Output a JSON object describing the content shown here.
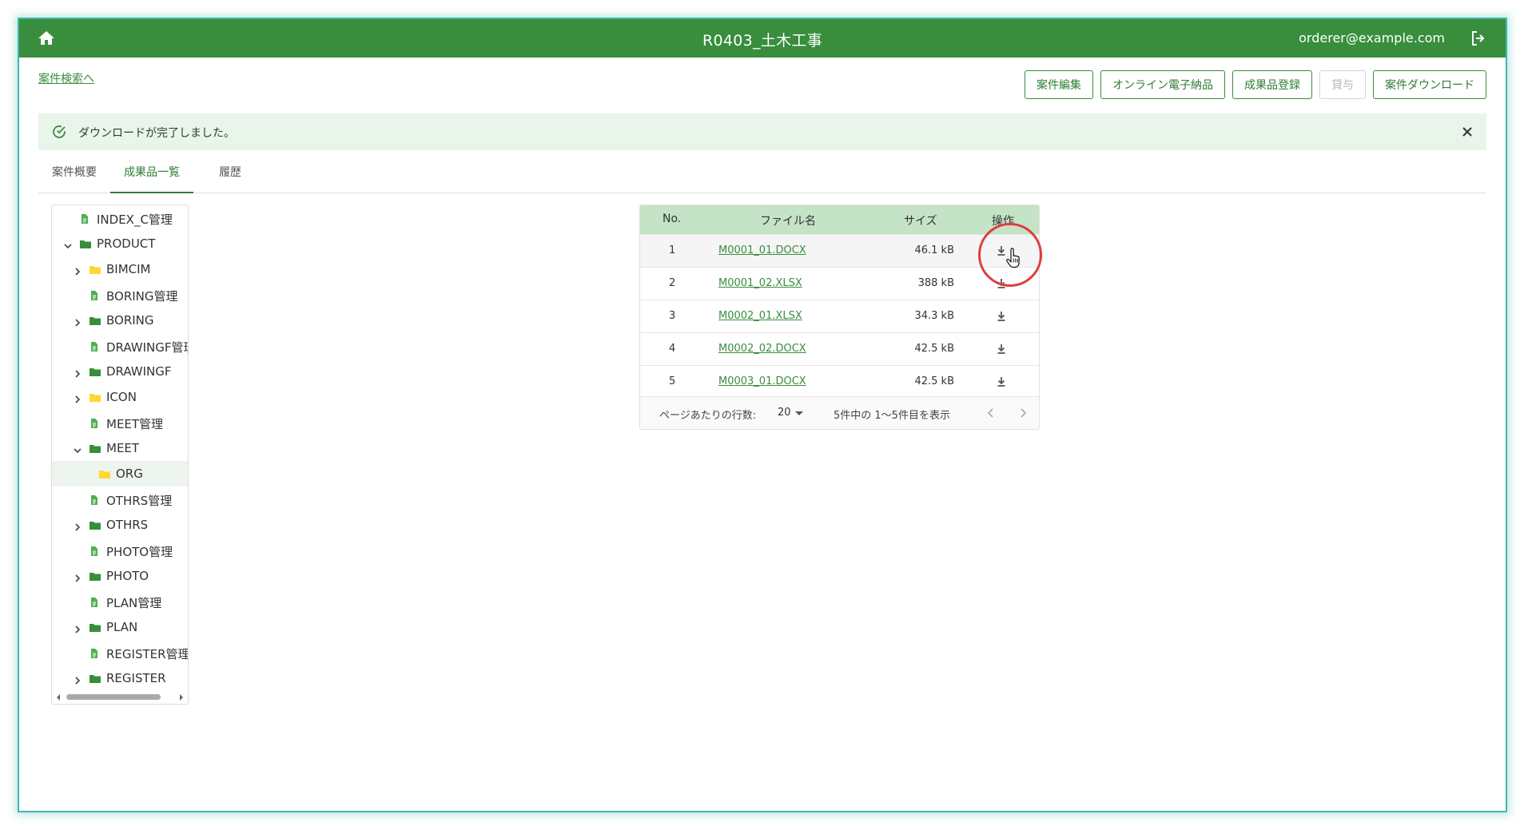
{
  "header": {
    "title": "R0403_土木工事",
    "user_email": "orderer@example.com"
  },
  "nav": {
    "back_link": "案件検索へ"
  },
  "actions": {
    "edit": "案件編集",
    "online_delivery": "オンライン電子納品",
    "register_deliverable": "成果品登録",
    "lend": "貸与",
    "download_case": "案件ダウンロード"
  },
  "alert": {
    "message": "ダウンロードが完了しました。"
  },
  "tabs": [
    {
      "label": "案件概要",
      "active": false
    },
    {
      "label": "成果品一覧",
      "active": true
    },
    {
      "label": "履歴",
      "active": false
    }
  ],
  "tree": [
    {
      "label": "INDEX_C管理",
      "type": "file",
      "depth": 0,
      "expander": "none"
    },
    {
      "label": "PRODUCT",
      "type": "folder",
      "depth": 0,
      "expander": "expanded"
    },
    {
      "label": "BIMCIM",
      "type": "folder-light",
      "depth": 1,
      "expander": "collapsed"
    },
    {
      "label": "BORING管理",
      "type": "file",
      "depth": 1,
      "expander": "none"
    },
    {
      "label": "BORING",
      "type": "folder",
      "depth": 1,
      "expander": "collapsed"
    },
    {
      "label": "DRAWINGF管理",
      "type": "file",
      "depth": 1,
      "expander": "none"
    },
    {
      "label": "DRAWINGF",
      "type": "folder",
      "depth": 1,
      "expander": "collapsed"
    },
    {
      "label": "ICON",
      "type": "folder-light",
      "depth": 1,
      "expander": "collapsed"
    },
    {
      "label": "MEET管理",
      "type": "file",
      "depth": 1,
      "expander": "none"
    },
    {
      "label": "MEET",
      "type": "folder",
      "depth": 1,
      "expander": "expanded"
    },
    {
      "label": "ORG",
      "type": "folder-light",
      "depth": 2,
      "expander": "none",
      "selected": true
    },
    {
      "label": "OTHRS管理",
      "type": "file",
      "depth": 1,
      "expander": "none"
    },
    {
      "label": "OTHRS",
      "type": "folder",
      "depth": 1,
      "expander": "collapsed"
    },
    {
      "label": "PHOTO管理",
      "type": "file",
      "depth": 1,
      "expander": "none"
    },
    {
      "label": "PHOTO",
      "type": "folder",
      "depth": 1,
      "expander": "collapsed"
    },
    {
      "label": "PLAN管理",
      "type": "file",
      "depth": 1,
      "expander": "none"
    },
    {
      "label": "PLAN",
      "type": "folder",
      "depth": 1,
      "expander": "collapsed"
    },
    {
      "label": "REGISTER管理",
      "type": "file",
      "depth": 1,
      "expander": "none"
    },
    {
      "label": "REGISTER",
      "type": "folder",
      "depth": 1,
      "expander": "collapsed"
    }
  ],
  "table": {
    "headers": {
      "no": "No.",
      "filename": "ファイル名",
      "size": "サイズ",
      "ops": "操作"
    },
    "rows": [
      {
        "no": "1",
        "filename": "M0001_01.DOCX",
        "size": "46.1 kB"
      },
      {
        "no": "2",
        "filename": "M0001_02.XLSX",
        "size": "388 kB"
      },
      {
        "no": "3",
        "filename": "M0002_01.XLSX",
        "size": "34.3 kB"
      },
      {
        "no": "4",
        "filename": "M0002_02.DOCX",
        "size": "42.5 kB"
      },
      {
        "no": "5",
        "filename": "M0003_01.DOCX",
        "size": "42.5 kB"
      }
    ],
    "footer": {
      "rows_per_page_label": "ページあたりの行数:",
      "rows_per_page_value": "20",
      "range_text": "5件中の 1〜5件目を表示"
    }
  },
  "colors": {
    "primary": "#388e3c",
    "header_row": "#c5e3c7",
    "alert_bg": "#e9f4ea",
    "file_icon": "#4caf50",
    "folder_icon": "#388e3c",
    "folder_light_icon": "#fdd835",
    "annotation": "#e03c3c"
  },
  "icons": {
    "home": "home-icon",
    "logout": "logout-icon",
    "alert": "check-circle-icon",
    "close": "close-icon",
    "download": "download-icon"
  }
}
